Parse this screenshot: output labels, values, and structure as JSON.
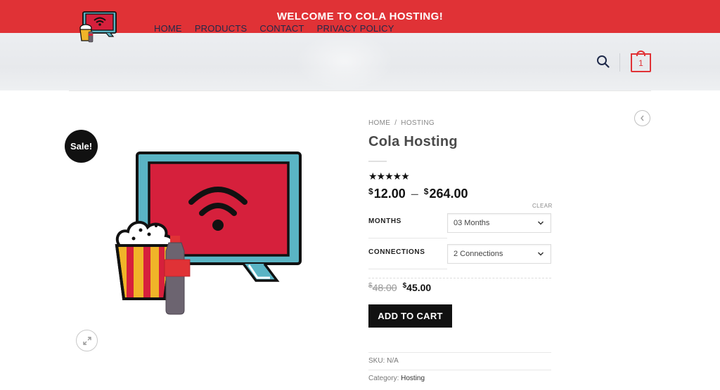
{
  "announcement": "WELCOME TO COLA HOSTING!",
  "nav": {
    "items": [
      "HOME",
      "PRODUCTS",
      "CONTACT",
      "PRIVACY POLICY"
    ]
  },
  "cart": {
    "count": "1"
  },
  "badge": {
    "sale": "Sale!"
  },
  "breadcrumb": {
    "home": "HOME",
    "sep": "/",
    "current": "HOSTING"
  },
  "product": {
    "title": "Cola Hosting",
    "stars": "★★★★★",
    "price_min_symbol": "$",
    "price_min": "12.00",
    "price_sep": "–",
    "price_max_symbol": "$",
    "price_max": "264.00"
  },
  "variations": {
    "clear_label": "CLEAR",
    "months_label": "MONTHS",
    "months_value": "03 Months",
    "connections_label": "CONNECTIONS",
    "connections_value": "2 Connections"
  },
  "variation_price": {
    "old_symbol": "$",
    "old": "48.00",
    "new_symbol": "$",
    "new": "45.00"
  },
  "add_to_cart": "ADD TO CART",
  "meta": {
    "sku_label": "SKU:",
    "sku_value": "N/A",
    "category_label": "Category:",
    "category_value": "Hosting"
  },
  "colors": {
    "accent": "#e03236",
    "dark": "#111111",
    "nav_text": "#1f2a4a"
  },
  "icons": [
    "search-icon",
    "cart-icon",
    "zoom-expand-icon",
    "chevron-left-icon",
    "chevron-down-icon",
    "star-icon"
  ]
}
